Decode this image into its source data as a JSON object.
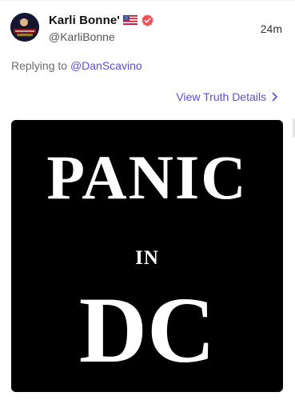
{
  "post": {
    "author": {
      "display_name": "Karli Bonne'",
      "handle": "@KarliBonne",
      "flag_icon": "us-flag-icon",
      "verified_icon": "verified-badge-icon",
      "verified_color": "#f0515b"
    },
    "timestamp": "24m",
    "reply": {
      "prefix": "Replying to",
      "mention": "@DanScavino"
    },
    "details_link": {
      "label": "View Truth Details",
      "icon": "chevron-right-icon"
    },
    "media": {
      "line1": "PANIC",
      "line2": "IN",
      "line3": "DC",
      "background": "#000000",
      "text_color": "#ffffff"
    }
  },
  "colors": {
    "link": "#5b4fd8",
    "name": "#111111",
    "muted": "#6b6b6b"
  }
}
